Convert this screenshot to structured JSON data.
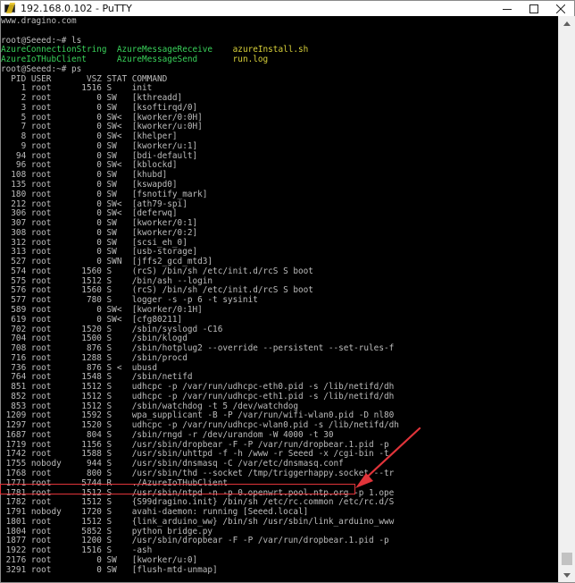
{
  "window": {
    "title": "192.168.0.102 - PuTTY",
    "app_icon": "putty-icon",
    "controls": [
      "minimize-icon",
      "maximize-icon",
      "close-icon"
    ]
  },
  "colors": {
    "terminal_bg": "#000000",
    "terminal_fg": "#bdbdbd",
    "ls_green": "#39d15a",
    "ls_yellow": "#d8d13a",
    "annotation_red": "#e0343a"
  },
  "terminal": {
    "lines": [
      [
        {
          "t": "www.dragino.com"
        }
      ],
      [
        {
          "t": ""
        }
      ],
      [
        {
          "t": "root@Seeed:~# ls"
        }
      ],
      [
        {
          "t": "AzureConnectionString",
          "c": "g"
        },
        {
          "t": "  "
        },
        {
          "t": "AzureMessageReceive",
          "c": "g"
        },
        {
          "t": "    "
        },
        {
          "t": "azureInstall.sh",
          "c": "y"
        }
      ],
      [
        {
          "t": "AzureIoTHubClient",
          "c": "g"
        },
        {
          "t": "      "
        },
        {
          "t": "AzureMessageSend",
          "c": "g"
        },
        {
          "t": "       "
        },
        {
          "t": "run.log",
          "c": "y"
        }
      ],
      [
        {
          "t": "root@Seeed:~# ps"
        }
      ],
      [
        {
          "t": "  PID USER       VSZ STAT COMMAND"
        }
      ],
      [
        {
          "t": "    1 root      1516 S    init"
        }
      ],
      [
        {
          "t": "    2 root         0 SW   [kthreadd]"
        }
      ],
      [
        {
          "t": "    3 root         0 SW   [ksoftirqd/0]"
        }
      ],
      [
        {
          "t": "    5 root         0 SW<  [kworker/0:0H]"
        }
      ],
      [
        {
          "t": "    7 root         0 SW<  [kworker/u:0H]"
        }
      ],
      [
        {
          "t": "    8 root         0 SW<  [khelper]"
        }
      ],
      [
        {
          "t": "    9 root         0 SW   [kworker/u:1]"
        }
      ],
      [
        {
          "t": "   94 root         0 SW   [bdi-default]"
        }
      ],
      [
        {
          "t": "   96 root         0 SW<  [kblockd]"
        }
      ],
      [
        {
          "t": "  108 root         0 SW   [khubd]"
        }
      ],
      [
        {
          "t": "  135 root         0 SW   [kswapd0]"
        }
      ],
      [
        {
          "t": "  180 root         0 SW   [fsnotify_mark]"
        }
      ],
      [
        {
          "t": "  212 root         0 SW<  [ath79-spi]"
        }
      ],
      [
        {
          "t": "  306 root         0 SW<  [deferwq]"
        }
      ],
      [
        {
          "t": "  307 root         0 SW   [kworker/0:1]"
        }
      ],
      [
        {
          "t": "  308 root         0 SW   [kworker/0:2]"
        }
      ],
      [
        {
          "t": "  312 root         0 SW   [scsi_eh_0]"
        }
      ],
      [
        {
          "t": "  313 root         0 SW   [usb-storage]"
        }
      ],
      [
        {
          "t": "  527 root         0 SWN  [jffs2_gcd_mtd3]"
        }
      ],
      [
        {
          "t": "  574 root      1560 S    (rcS) /bin/sh /etc/init.d/rcS S boot"
        }
      ],
      [
        {
          "t": "  575 root      1512 S    /bin/ash --login"
        }
      ],
      [
        {
          "t": "  576 root      1560 S    (rcS) /bin/sh /etc/init.d/rcS S boot"
        }
      ],
      [
        {
          "t": "  577 root       780 S    logger -s -p 6 -t sysinit"
        }
      ],
      [
        {
          "t": "  589 root         0 SW<  [kworker/0:1H]"
        }
      ],
      [
        {
          "t": "  619 root         0 SW<  [cfg80211]"
        }
      ],
      [
        {
          "t": "  702 root      1520 S    /sbin/syslogd -C16"
        }
      ],
      [
        {
          "t": "  704 root      1500 S    /sbin/klogd"
        }
      ],
      [
        {
          "t": "  708 root       876 S    /sbin/hotplug2 --override --persistent --set-rules-f"
        }
      ],
      [
        {
          "t": "  716 root      1288 S    /sbin/procd"
        }
      ],
      [
        {
          "t": "  736 root       876 S <  ubusd"
        }
      ],
      [
        {
          "t": "  764 root      1548 S    /sbin/netifd"
        }
      ],
      [
        {
          "t": "  851 root      1512 S    udhcpc -p /var/run/udhcpc-eth0.pid -s /lib/netifd/dh"
        }
      ],
      [
        {
          "t": "  852 root      1512 S    udhcpc -p /var/run/udhcpc-eth1.pid -s /lib/netifd/dh"
        }
      ],
      [
        {
          "t": "  853 root      1512 S    /sbin/watchdog -t 5 /dev/watchdog"
        }
      ],
      [
        {
          "t": " 1209 root      1592 S    wpa_supplicant -B -P /var/run/wifi-wlan0.pid -D nl80"
        }
      ],
      [
        {
          "t": " 1297 root      1520 S    udhcpc -p /var/run/udhcpc-wlan0.pid -s /lib/netifd/dh"
        }
      ],
      [
        {
          "t": " 1687 root       804 S    /sbin/rngd -r /dev/urandom -W 4000 -t 30"
        }
      ],
      [
        {
          "t": " 1719 root      1156 S    /usr/sbin/dropbear -F -P /var/run/dropbear.1.pid -p"
        }
      ],
      [
        {
          "t": " 1742 root      1588 S    /usr/sbin/uhttpd -f -h /www -r Seeed -x /cgi-bin -t"
        }
      ],
      [
        {
          "t": " 1755 nobody     944 S    /usr/sbin/dnsmasq -C /var/etc/dnsmasq.conf"
        }
      ],
      [
        {
          "t": " 1768 root       800 S    /usr/sbin/thd --socket /tmp/triggerhappy.socket --tr"
        }
      ],
      [
        {
          "t": " 1771 root      5744 R    ./AzureIoTHubClient"
        }
      ],
      [
        {
          "t": " 1781 root      1512 S    /usr/sbin/ntpd -n -p 0.openwrt.pool.ntp.org -p 1.ope"
        }
      ],
      [
        {
          "t": " 1782 root      1512 S    {S99dragino.init} /bin/sh /etc/rc.common /etc/rc.d/S"
        }
      ],
      [
        {
          "t": " 1791 nobody    1720 S    avahi-daemon: running [Seeed.local]"
        }
      ],
      [
        {
          "t": " 1801 root      1512 S    {link_arduino_ww} /bin/sh /usr/sbin/link_arduino_www"
        }
      ],
      [
        {
          "t": " 1804 root      5852 S    python bridge.py"
        }
      ],
      [
        {
          "t": " 1877 root      1200 S    /usr/sbin/dropbear -F -P /var/run/dropbear.1.pid -p"
        }
      ],
      [
        {
          "t": " 1922 root      1516 S    -ash"
        }
      ],
      [
        {
          "t": " 2176 root         0 SW   [kworker/u:0]"
        }
      ],
      [
        {
          "t": " 3291 root         0 SW   [flush-mtd-unmap]"
        }
      ]
    ]
  }
}
